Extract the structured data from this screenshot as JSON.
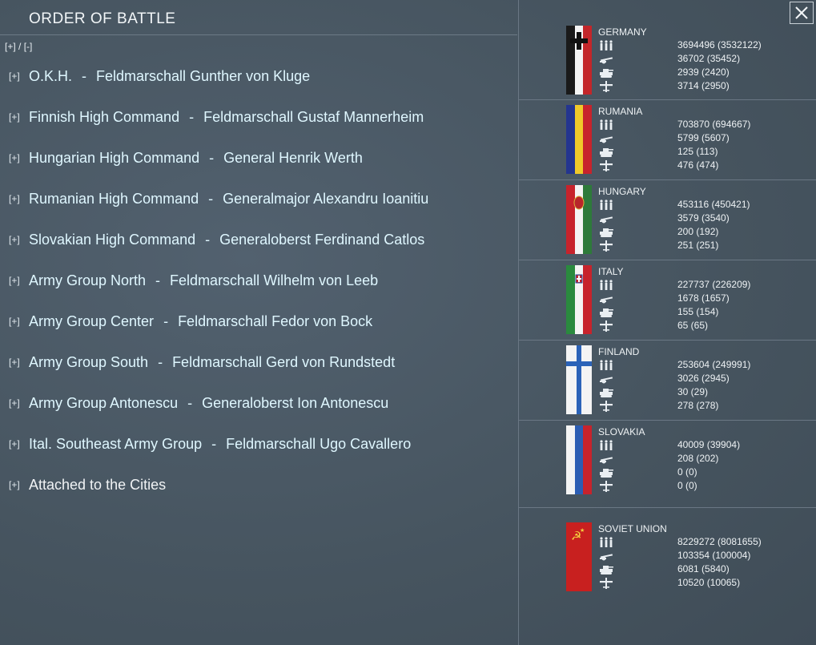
{
  "header": {
    "title": "ORDER OF BATTLE",
    "expand_label": "[+]",
    "slash": "/",
    "collapse_label": "[-]"
  },
  "commands": [
    {
      "toggle": "[+]",
      "name": "O.K.H.",
      "sep": "-",
      "leader": "Feldmarschall Gunther von Kluge"
    },
    {
      "toggle": "[+]",
      "name": "Finnish High Command",
      "sep": "-",
      "leader": "Feldmarschall Gustaf Mannerheim"
    },
    {
      "toggle": "[+]",
      "name": "Hungarian High Command",
      "sep": "-",
      "leader": "General Henrik Werth"
    },
    {
      "toggle": "[+]",
      "name": "Rumanian High Command",
      "sep": "-",
      "leader": "Generalmajor Alexandru Ioanitiu"
    },
    {
      "toggle": "[+]",
      "name": "Slovakian High Command",
      "sep": "-",
      "leader": "Generaloberst Ferdinand Catlos"
    },
    {
      "toggle": "[+]",
      "name": "Army Group North",
      "sep": "-",
      "leader": "Feldmarschall Wilhelm von Leeb"
    },
    {
      "toggle": "[+]",
      "name": "Army Group Center",
      "sep": "-",
      "leader": "Feldmarschall Fedor von Bock"
    },
    {
      "toggle": "[+]",
      "name": "Army Group South",
      "sep": "-",
      "leader": "Feldmarschall Gerd von Rundstedt"
    },
    {
      "toggle": "[+]",
      "name": "Army Group Antonescu",
      "sep": "-",
      "leader": "Generaloberst Ion Antonescu"
    },
    {
      "toggle": "[+]",
      "name": "Ital. Southeast Army Group",
      "sep": "-",
      "leader": "Feldmarschall Ugo Cavallero"
    },
    {
      "toggle": "[+]",
      "name": "Attached to the Cities",
      "sep": "",
      "leader": ""
    }
  ],
  "nations": [
    {
      "name": "GERMANY",
      "flag": "germany",
      "stats": [
        "3694496 (3532122)",
        "36702 (35452)",
        "2939 (2420)",
        "3714 (2950)"
      ]
    },
    {
      "name": "RUMANIA",
      "flag": "rumania",
      "stats": [
        "703870 (694667)",
        "5799 (5607)",
        "125 (113)",
        "476 (474)"
      ]
    },
    {
      "name": "HUNGARY",
      "flag": "hungary",
      "stats": [
        "453116 (450421)",
        "3579 (3540)",
        "200 (192)",
        "251 (251)"
      ]
    },
    {
      "name": "ITALY",
      "flag": "italy",
      "stats": [
        "227737 (226209)",
        "1678 (1657)",
        "155 (154)",
        "65 (65)"
      ]
    },
    {
      "name": "FINLAND",
      "flag": "finland",
      "stats": [
        "253604 (249991)",
        "3026 (2945)",
        "30 (29)",
        "278 (278)"
      ]
    },
    {
      "name": "SLOVAKIA",
      "flag": "slovakia",
      "stats": [
        "40009 (39904)",
        "208 (202)",
        "0 (0)",
        "0 (0)"
      ]
    },
    {
      "name": "SOVIET UNION",
      "flag": "soviet",
      "stats": [
        "8229272 (8081655)",
        "103354 (100004)",
        "6081 (5840)",
        "10520 (10065)"
      ]
    }
  ],
  "stat_icons": [
    "infantry-icon",
    "artillery-icon",
    "tank-icon",
    "aircraft-icon"
  ],
  "colors": {
    "accent_text": "#dff7ff",
    "background": "#4a5967"
  }
}
